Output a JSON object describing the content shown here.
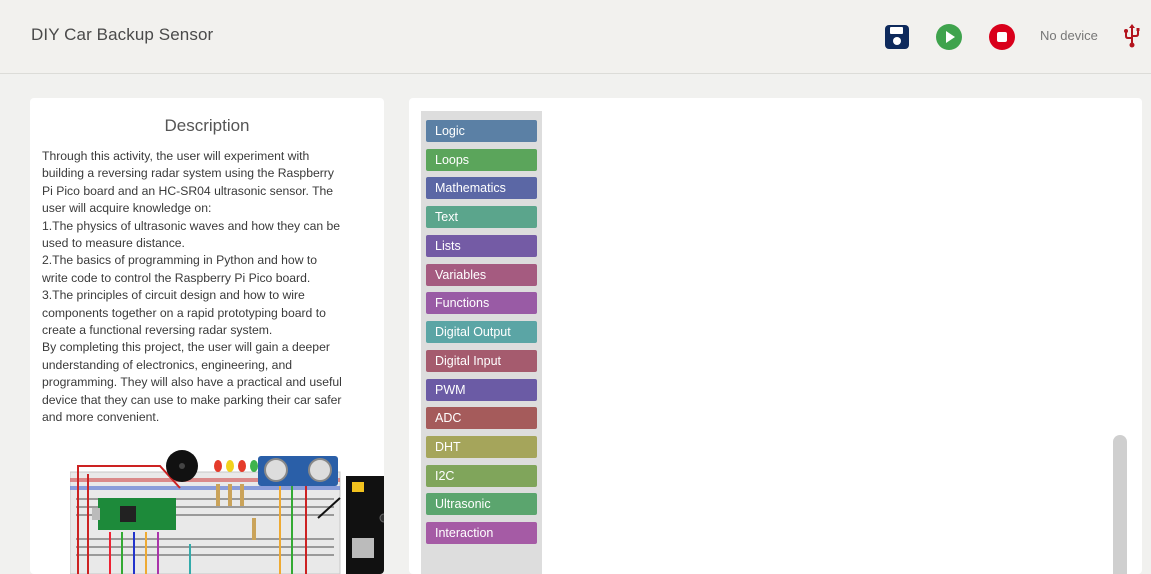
{
  "app": {
    "title": "DIY Car Backup Sensor",
    "device_status": "No device"
  },
  "icons": {
    "save": "save-icon",
    "run": "play-icon",
    "stop": "stop-icon",
    "usb": "usb-icon"
  },
  "colors": {
    "save": "#0e2a5c",
    "run": "#3fa34d",
    "stop": "#d9001b",
    "usb": "#b3141d"
  },
  "description": {
    "heading": "Description",
    "lines": [
      "Through this activity, the user will experiment with",
      "building a reversing radar system using the Raspberry",
      "Pi Pico board and an HC-SR04 ultrasonic sensor. The",
      "user will acquire knowledge on:",
      "1.The physics of ultrasonic waves and how they can be",
      "used to measure distance.",
      "2.The basics of programming in Python and how to",
      "write code to control the Raspberry Pi Pico board.",
      "3.The principles of circuit design and how to wire",
      "components together on a rapid prototyping board to",
      "create a functional reversing radar system.",
      "By completing this project, the user will gain a deeper",
      "understanding of electronics, engineering, and",
      "programming. They will also have a practical and useful",
      "device that they can use to make parking their car safer",
      "and more convenient."
    ]
  },
  "toolbox": {
    "categories": [
      {
        "label": "Logic",
        "color": "#5b80a5"
      },
      {
        "label": "Loops",
        "color": "#5ba55b"
      },
      {
        "label": "Mathematics",
        "color": "#5b67a5"
      },
      {
        "label": "Text",
        "color": "#5ba58c"
      },
      {
        "label": "Lists",
        "color": "#745ba5"
      },
      {
        "label": "Variables",
        "color": "#a55b80"
      },
      {
        "label": "Functions",
        "color": "#995ba5"
      },
      {
        "label": "Digital Output",
        "color": "#5ba5a5"
      },
      {
        "label": "Digital Input",
        "color": "#a55b6e"
      },
      {
        "label": "PWM",
        "color": "#6b5ba5"
      },
      {
        "label": "ADC",
        "color": "#a55b5b"
      },
      {
        "label": "DHT",
        "color": "#a5a55b"
      },
      {
        "label": "I2C",
        "color": "#80a55b"
      },
      {
        "label": "Ultrasonic",
        "color": "#5ba56e"
      },
      {
        "label": "Interaction",
        "color": "#a55ba5"
      }
    ]
  }
}
